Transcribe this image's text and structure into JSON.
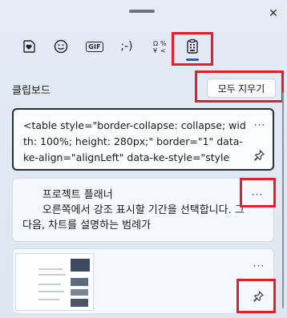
{
  "window": {
    "close_glyph": "✕"
  },
  "tabs": [
    {
      "name": "favorites",
      "icon": "heart-sticker-icon"
    },
    {
      "name": "emoji",
      "icon": "smiley-icon"
    },
    {
      "name": "gif",
      "icon": "gif-icon",
      "label": "GIF"
    },
    {
      "name": "kaomoji",
      "icon": "kaomoji-icon",
      "label": ";-)"
    },
    {
      "name": "symbols",
      "icon": "symbols-icon"
    },
    {
      "name": "clipboard",
      "icon": "clipboard-icon",
      "selected": true
    }
  ],
  "clipboard": {
    "title": "클립보드",
    "clear_all_label": "모두 지우기",
    "items": [
      {
        "type": "text",
        "text": "<table style=\"border-collapse: collapse; width: 100%; height: 280px;\" border=\"1\" data-ke-align=\"alignLeft\" data-ke-style=\"style",
        "more_label": "···"
      },
      {
        "type": "text",
        "text": "      프로젝트 플래너\n      오른쪽에서 강조 표시할 기간을 선택합니다. 그 다음, 차트를 설명하는 범례가",
        "more_label": "···"
      },
      {
        "type": "image",
        "more_label": "···"
      }
    ]
  },
  "colors": {
    "accent": "#1b62c4",
    "highlight": "#e0202a"
  }
}
